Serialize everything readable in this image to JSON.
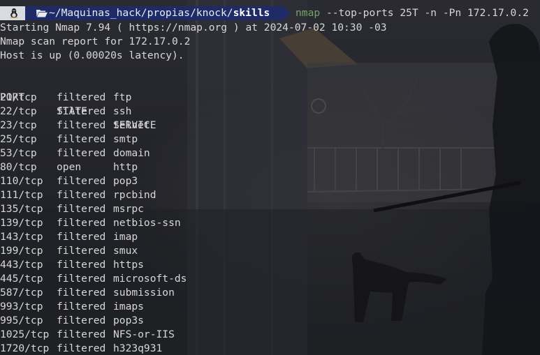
{
  "prompt": {
    "os_icon": "linux-tux-icon",
    "folder_icon": "folder-open-icon",
    "path_prefix": "~/Maquinas_hack/propias/knock/",
    "path_current": "skills",
    "command_name": "nmap",
    "command_args": " --top-ports 25T -n -Pn 172.17.0.2"
  },
  "output": {
    "line1": "Starting Nmap 7.94 ( https://nmap.org ) at 2024-07-02 10:30 -03",
    "line2": "Nmap scan report for 172.17.0.2",
    "line3": "Host is up (0.00020s latency).",
    "header": {
      "port": "PORT",
      "state": "STATE",
      "service": "SERVICE"
    },
    "rows": [
      {
        "port": "21/tcp",
        "state": "filtered",
        "service": "ftp"
      },
      {
        "port": "22/tcp",
        "state": "filtered",
        "service": "ssh"
      },
      {
        "port": "23/tcp",
        "state": "filtered",
        "service": "telnet"
      },
      {
        "port": "25/tcp",
        "state": "filtered",
        "service": "smtp"
      },
      {
        "port": "53/tcp",
        "state": "filtered",
        "service": "domain"
      },
      {
        "port": "80/tcp",
        "state": "open",
        "service": "http"
      },
      {
        "port": "110/tcp",
        "state": "filtered",
        "service": "pop3"
      },
      {
        "port": "111/tcp",
        "state": "filtered",
        "service": "rpcbind"
      },
      {
        "port": "135/tcp",
        "state": "filtered",
        "service": "msrpc"
      },
      {
        "port": "139/tcp",
        "state": "filtered",
        "service": "netbios-ssn"
      },
      {
        "port": "143/tcp",
        "state": "filtered",
        "service": "imap"
      },
      {
        "port": "199/tcp",
        "state": "filtered",
        "service": "smux"
      },
      {
        "port": "443/tcp",
        "state": "filtered",
        "service": "https"
      },
      {
        "port": "445/tcp",
        "state": "filtered",
        "service": "microsoft-ds"
      },
      {
        "port": "587/tcp",
        "state": "filtered",
        "service": "submission"
      },
      {
        "port": "993/tcp",
        "state": "filtered",
        "service": "imaps"
      },
      {
        "port": "995/tcp",
        "state": "filtered",
        "service": "pop3s"
      },
      {
        "port": "1025/tcp",
        "state": "filtered",
        "service": "NFS-or-IIS"
      },
      {
        "port": "1720/tcp",
        "state": "filtered",
        "service": "h323q931"
      }
    ]
  },
  "colors": {
    "prompt_os_bg": "#d8dbe2",
    "prompt_path_bg": "#1f2b66",
    "command_green": "#76a16a",
    "text": "#d8d8d8"
  }
}
